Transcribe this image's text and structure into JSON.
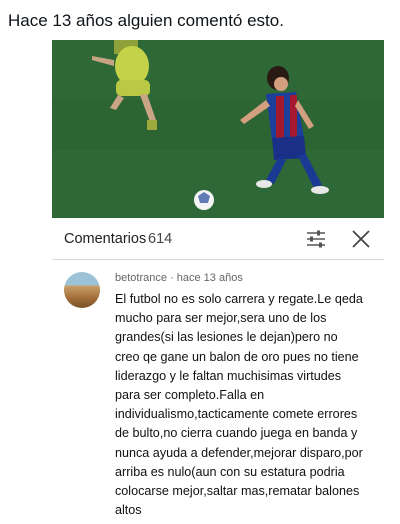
{
  "tweet": {
    "caption": "Hace 13 años alguien comentó esto."
  },
  "comments_panel": {
    "title": "Comentarios",
    "count": "614",
    "icons": {
      "filter": "filter-sliders-icon",
      "close": "close-icon"
    }
  },
  "comment": {
    "author": "betotrance",
    "separator": " · ",
    "time": "hace 13 años",
    "text": "El futbol no es solo carrera y regate.Le qeda\nmucho para ser mejor,sera uno de los\ngrandes(si las lesiones le dejan)pero no\ncreo qe gane un balon de oro pues no tiene\nliderazgo y le faltan muchisimas virtudes\npara ser completo.Falla en\nindividualismo,tacticamente comete errores\nde bulto,no cierra cuando juega en banda y\nnunca ayuda a defender,mejorar disparo,por\narriba es nulo(aun con su estatura podria\ncolocarse mejor,saltar mas,rematar balones\naltos"
  },
  "colors": {
    "pitch": "#2d6635",
    "kit_yellow": "#c8d64a",
    "kit_blue": "#1c3f9c",
    "kit_red": "#a4192e"
  }
}
